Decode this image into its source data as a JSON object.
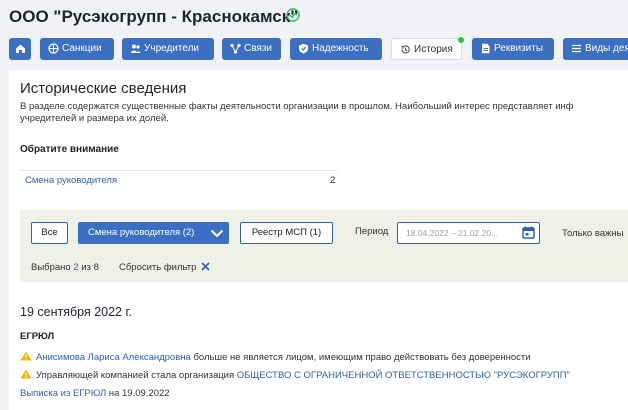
{
  "company": {
    "name": "ООО \"Русэкогрупп - Краснокамск\""
  },
  "nav": {
    "items": [
      {
        "label": "",
        "icon": "home-icon"
      },
      {
        "label": "Санкции",
        "icon": "sanctions-icon"
      },
      {
        "label": "Учредители",
        "icon": "founders-icon"
      },
      {
        "label": "Связи",
        "icon": "connections-icon"
      },
      {
        "label": "Надежность",
        "icon": "shield-icon"
      },
      {
        "label": "История",
        "icon": "history-icon",
        "active": true
      },
      {
        "label": "Реквизиты",
        "icon": "document-icon"
      },
      {
        "label": "Виды деят",
        "icon": "list-icon"
      }
    ]
  },
  "section": {
    "title": "Исторические сведения",
    "desc_line1": "В разделе содержатся существенные факты деятельности организации в прошлом. Наибольший интерес представляет инф",
    "desc_line2": "учредителей и размера их долей."
  },
  "notice": {
    "title": "Обратите внимание",
    "rows": [
      {
        "label": "Смена руководителя",
        "count": "2"
      }
    ]
  },
  "filters": {
    "all_label": "Все",
    "change_head_label": "Смена руководителя (2)",
    "msp_label": "Реестр МСП (1)",
    "period_label": "Период",
    "period_value": "18.04.2022 – 21.02.20...",
    "important_label": "Только важны",
    "selected_prefix": "Выбрано",
    "selected_count": "2",
    "selected_total": "из 8",
    "reset_label": "Сбросить фильтр"
  },
  "events": {
    "date": "19 сентября 2022 г.",
    "source": "ЕГРЮЛ",
    "item1_link": "Анисимова Лариса Александровна",
    "item1_text": " больше не является лицом, имеющим право действовать без доверенности",
    "item2_text": "Управляющей компанией стала организация ",
    "item2_link": "ОБЩЕСТВО С ОГРАНИЧЕННОЙ ОТВЕТСТВЕННОСТЬЮ \"РУСЭКОГРУПП\"",
    "extract_link": "Выписка из ЕГРЮЛ",
    "extract_date": " на 19.09.2022"
  },
  "colors": {
    "accent": "#3b6fc4",
    "link": "#2f5fb3",
    "ok": "#2fbf4f",
    "warning": "#f0b400"
  }
}
